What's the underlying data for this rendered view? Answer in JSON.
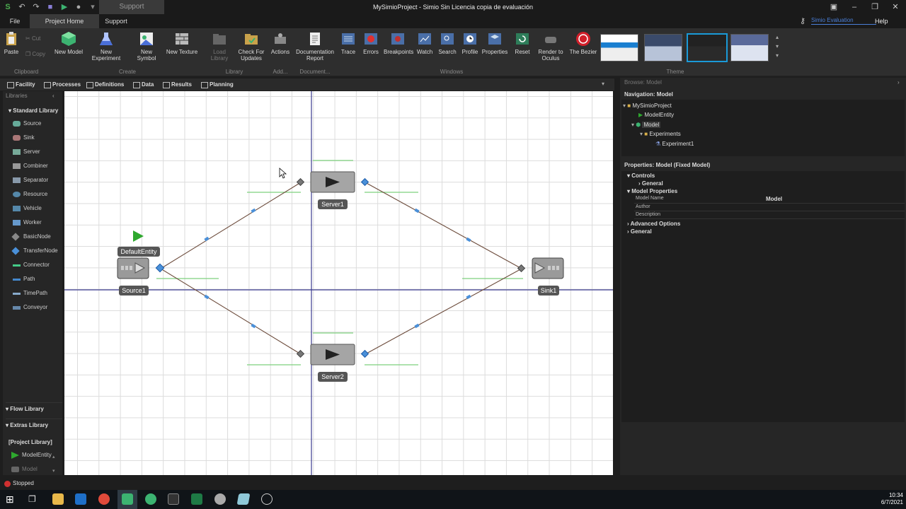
{
  "window": {
    "title": "MySimioProject - Simio Sin Licencia copia de evaluación",
    "context_tab": "Support"
  },
  "tabs": {
    "file": "File",
    "project_home": "Project Home",
    "support": "Support",
    "account": "Simio Evaluation",
    "help": "Help"
  },
  "ribbon": {
    "paste": "Paste",
    "cut": "Cut",
    "copy": "Copy",
    "new_model": "New Model",
    "new_experiment": "New Experiment",
    "new_symbol": "New Symbol",
    "new_texture": "New Texture",
    "load_library": "Load Library",
    "check_updates": "Check For Updates",
    "actions": "Actions",
    "doc_report": "Documentation Report",
    "trace": "Trace",
    "errors": "Errors",
    "breakpoints": "Breakpoints",
    "watch": "Watch",
    "search": "Search",
    "profile": "Profile",
    "properties": "Properties",
    "reset": "Reset",
    "render_oculus": "Render to Oculus",
    "bezier": "The Bezier",
    "groups": {
      "clipboard": "Clipboard",
      "create": "Create",
      "library": "Library",
      "add": "Add...",
      "document": "Document...",
      "windows": "Windows",
      "theme": "Theme"
    }
  },
  "subtabs": {
    "facility": "Facility",
    "processes": "Processes",
    "definitions": "Definitions",
    "data": "Data",
    "results": "Results",
    "planning": "Planning"
  },
  "libraries": {
    "header": "Libraries",
    "standard": "Standard Library",
    "items": [
      "Source",
      "Sink",
      "Server",
      "Combiner",
      "Separator",
      "Resource",
      "Vehicle",
      "Worker",
      "BasicNode",
      "TransferNode",
      "Connector",
      "Path",
      "TimePath",
      "Conveyor"
    ],
    "flow": "Flow Library",
    "extras": "Extras Library",
    "project": "[Project Library]",
    "project_items": [
      "ModelEntity",
      "Model"
    ]
  },
  "model": {
    "source": "Source1",
    "entity": "DefaultEntity",
    "server1": "Server1",
    "server2": "Server2",
    "sink": "Sink1"
  },
  "browse": {
    "header": "Browse: Model",
    "nav_title": "Navigation: Model",
    "tree": [
      "MySimioProject",
      "ModelEntity",
      "Model",
      "Experiments",
      "Experiment1"
    ],
    "props_title": "Properties: Model (Fixed Model)",
    "controls": "Controls",
    "general_sub": "General",
    "model_props": "Model Properties",
    "model_name_label": "Model Name",
    "model_name_value": "Model",
    "author_label": "Author",
    "description_label": "Description",
    "advanced": "Advanced Options",
    "general": "General"
  },
  "status": {
    "state": "Stopped"
  },
  "taskbar": {
    "time": "10:34",
    "date": "6/7/2021"
  },
  "colors": {
    "accent": "#4a90d9",
    "play": "#2ea82e",
    "guide_line": "#3b3b8f",
    "green_line": "#7ed07e"
  }
}
